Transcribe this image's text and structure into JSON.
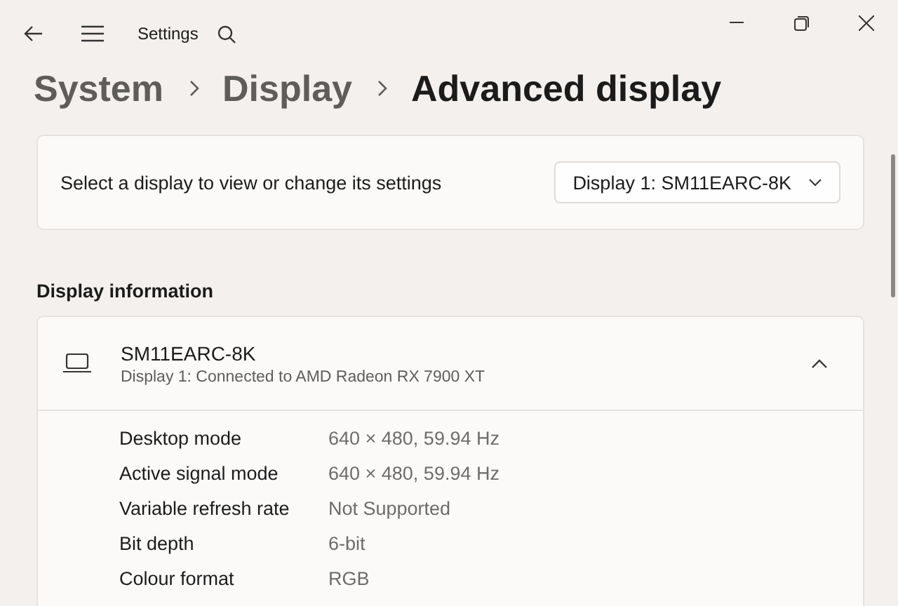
{
  "window": {
    "title": "Settings"
  },
  "breadcrumb": [
    {
      "label": "System",
      "selected": false
    },
    {
      "label": "Display",
      "selected": false
    },
    {
      "label": "Advanced display",
      "selected": true
    }
  ],
  "display_select": {
    "label": "Select a display to view or change its settings",
    "value": "Display 1: SM11EARC-8K"
  },
  "section_title": "Display information",
  "display_card": {
    "name": "SM11EARC-8K",
    "subtitle": "Display 1: Connected to AMD Radeon RX 7900 XT",
    "expanded": true,
    "rows": [
      {
        "label": "Desktop mode",
        "value": "640 × 480, 59.94 Hz"
      },
      {
        "label": "Active signal mode",
        "value": "640 × 480, 59.94 Hz"
      },
      {
        "label": "Variable refresh rate",
        "value": "Not Supported"
      },
      {
        "label": "Bit depth",
        "value": "6-bit"
      },
      {
        "label": "Colour format",
        "value": "RGB"
      }
    ]
  }
}
